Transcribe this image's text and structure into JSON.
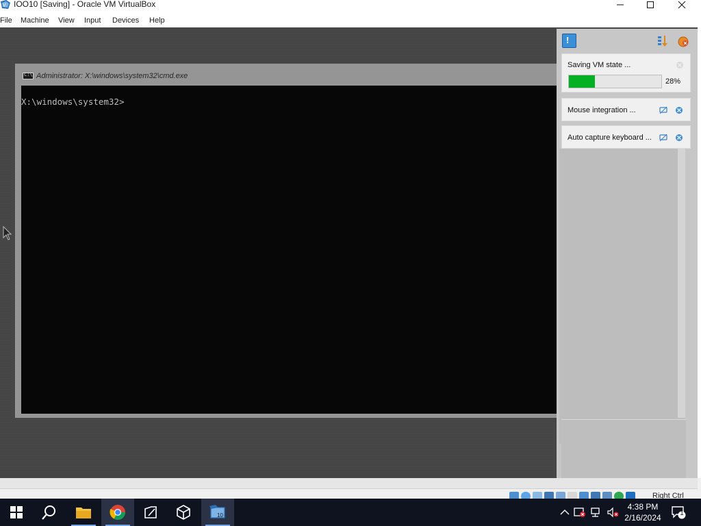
{
  "window": {
    "title": "IOO10 [Saving] - Oracle VM VirtualBox"
  },
  "menu": {
    "items": [
      "File",
      "Machine",
      "View",
      "Input",
      "Devices",
      "Help"
    ]
  },
  "cmd": {
    "title": "Administrator: X:\\windows\\system32\\cmd.exe",
    "icon_text": "C:\\",
    "prompt": "X:\\windows\\system32>"
  },
  "notifications": {
    "saving": {
      "text": "Saving VM state ...",
      "progress_percent": 28,
      "progress_label": "28%"
    },
    "mouse": {
      "text": "Mouse integration ..."
    },
    "keyboard": {
      "text": "Auto capture keyboard ..."
    }
  },
  "statusbar": {
    "host_key": "Right Ctrl"
  },
  "taskbar": {
    "time": "4:38 PM",
    "date": "2/16/2024",
    "notification_count": "1"
  },
  "colors": {
    "progress": "#06b025",
    "taskbar": "#0f1320",
    "accent": "#3b8fd6"
  }
}
